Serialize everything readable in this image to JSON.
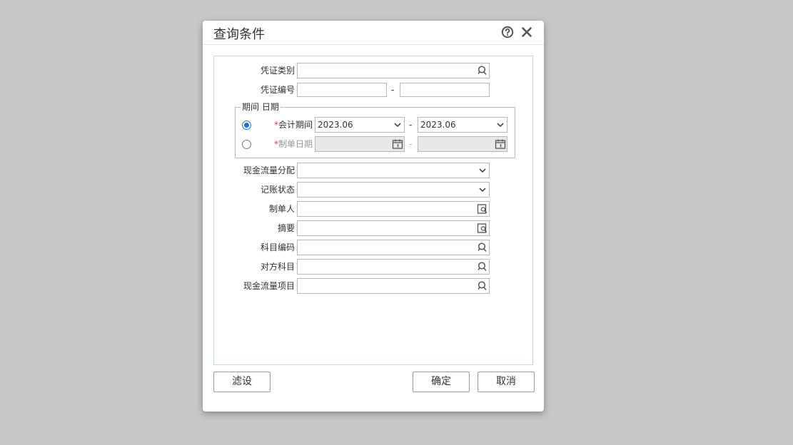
{
  "dialog": {
    "title": "查询条件",
    "help_icon": "help-circle-icon",
    "close_icon": "close-icon"
  },
  "form": {
    "voucher_type": {
      "label": "凭证类别",
      "value": "",
      "icon": "lookup-icon"
    },
    "voucher_no": {
      "label": "凭证编号",
      "from": "",
      "to": "",
      "separator": "-"
    },
    "period_group": {
      "legend": "期间 日期",
      "accounting_period": {
        "label": "会计期间",
        "required_mark": "*",
        "selected": true,
        "from": "2023.06",
        "to": "2023.06",
        "separator": "-"
      },
      "created_date": {
        "label": "制单日期",
        "required_mark": "*",
        "selected": false,
        "from": "",
        "to": "",
        "separator": "-",
        "icon": "calendar-icon"
      }
    },
    "cash_flow_allocation": {
      "label": "现金流量分配",
      "value": ""
    },
    "posting_status": {
      "label": "记账状态",
      "value": ""
    },
    "creator": {
      "label": "制单人",
      "value": "",
      "icon": "reference-icon"
    },
    "summary": {
      "label": "摘要",
      "value": "",
      "icon": "reference-icon"
    },
    "subject_code": {
      "label": "科目编码",
      "value": "",
      "icon": "lookup-icon"
    },
    "counter_subject": {
      "label": "对方科目",
      "value": "",
      "icon": "lookup-icon"
    },
    "cash_flow_item": {
      "label": "现金流量项目",
      "value": "",
      "icon": "lookup-icon"
    }
  },
  "footer": {
    "filter_settings": "滤设",
    "ok": "确定",
    "cancel": "取消"
  },
  "colors": {
    "backdrop": "#c8c8c8",
    "panel_border": "#c7d5de",
    "required": "#e5383b",
    "radio_accent": "#1a73e8"
  }
}
